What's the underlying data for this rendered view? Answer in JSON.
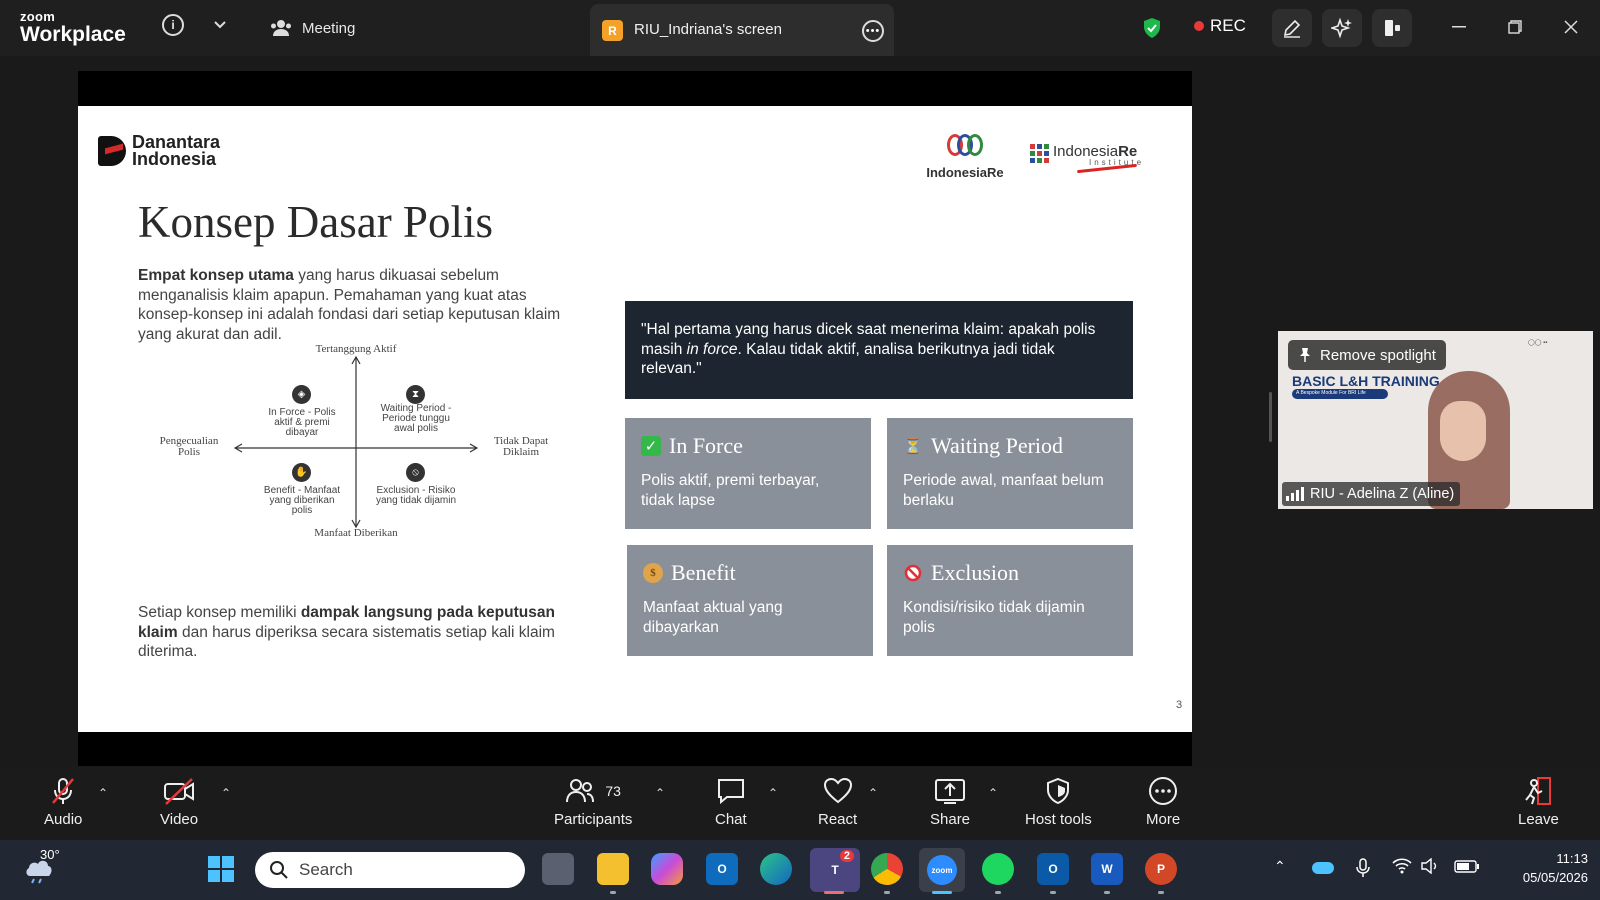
{
  "window": {
    "app_logo_top": "zoom",
    "app_logo_bottom": "Workplace",
    "meeting_label": "Meeting",
    "screen_tab_badge": "R",
    "screen_tab_label": "RIU_Indriana's screen",
    "rec_label": "REC"
  },
  "slide": {
    "org_logo_text_1": "Danantara",
    "org_logo_text_2": "Indonesia",
    "ire_logo_text": "IndonesiaRe",
    "iri_logo_text_1": "Indonesia",
    "iri_logo_text_2": "Re",
    "iri_logo_sub": "Institute",
    "title": "Konsep Dasar Polis",
    "intro_bold": "Empat konsep utama",
    "intro_rest": " yang harus dikuasai sebelum menganalisis klaim apapun. Pemahaman yang kuat atas konsep-konsep ini adalah fondasi dari setiap keputusan klaim yang akurat dan adil.",
    "diagram": {
      "top_label": "Tertanggung Aktif",
      "bottom_label": "Manfaat Diberikan",
      "left_label": "Pengecualian Polis",
      "right_label": "Tidak Dapat Diklaim",
      "q1": "In Force - Polis aktif & premi dibayar",
      "q2": "Waiting Period - Periode tunggu awal polis",
      "q3": "Benefit - Manfaat yang diberikan polis",
      "q4": "Exclusion - Risiko yang tidak dijamin"
    },
    "footer_pre": "Setiap konsep memiliki ",
    "footer_bold": "dampak langsung pada keputusan klaim",
    "footer_post": " dan harus diperiksa secara sistematis setiap kali klaim diterima.",
    "quote_pre": "\"Hal pertama yang harus dicek saat menerima klaim: apakah polis masih ",
    "quote_em": "in force",
    "quote_post": ". Kalau tidak aktif, analisa berikutnya jadi tidak relevan.\"",
    "cards": [
      {
        "icon": "check-icon",
        "title": "In Force",
        "desc": "Polis aktif, premi terbayar, tidak lapse"
      },
      {
        "icon": "hourglass-icon",
        "title": "Waiting Period",
        "desc": "Periode awal, manfaat belum berlaku"
      },
      {
        "icon": "money-bag-icon",
        "title": "Benefit",
        "desc": "Manfaat aktual yang dibayarkan"
      },
      {
        "icon": "prohibited-icon",
        "title": "Exclusion",
        "desc": "Kondisi/risiko tidak dijamin polis"
      }
    ],
    "page_number": "3"
  },
  "video": {
    "spotlight_label": "Remove spotlight",
    "participant_name": "RIU - Adelina Z (Aline)",
    "background_title": "BASIC L&H TRAINING",
    "background_subtitle": "A Bespoke Module For BRI Life"
  },
  "toolbar": {
    "audio": "Audio",
    "video": "Video",
    "participants": "Participants",
    "participants_count": "73",
    "chat": "Chat",
    "react": "React",
    "share": "Share",
    "host_tools": "Host tools",
    "more": "More",
    "leave": "Leave"
  },
  "taskbar": {
    "temperature": "30°",
    "search_placeholder": "Search",
    "teams_badge": "2",
    "time": "11:13",
    "date": "05/05/2026"
  },
  "colors": {
    "accent_red": "#e8393b",
    "shield_green": "#1fb84c",
    "quote_bg": "#1c2530",
    "card_bg": "#8a9099"
  }
}
